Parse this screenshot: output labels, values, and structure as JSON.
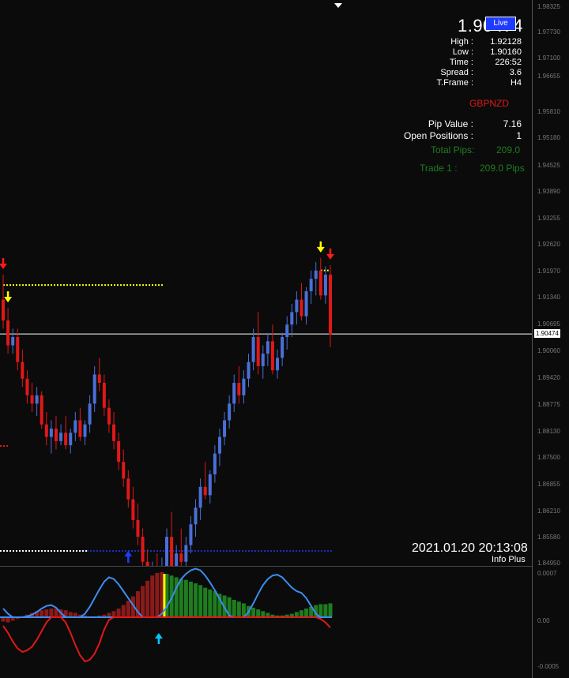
{
  "price": {
    "current": "1.90474",
    "badge": "Live"
  },
  "stats": [
    {
      "label": "High :",
      "value": "1.92128"
    },
    {
      "label": "Low :",
      "value": "1.90160"
    },
    {
      "label": "Time :",
      "value": "226:52"
    },
    {
      "label": "Spread :",
      "value": "3.6"
    },
    {
      "label": "T.Frame :",
      "value": "H4"
    }
  ],
  "symbol": "GBPNZD",
  "account": [
    {
      "label": "Pip Value :",
      "value": "7.16"
    },
    {
      "label": "Open Positions :",
      "value": "1"
    }
  ],
  "total_pips": {
    "label": "Total Pips:",
    "value": "209.0"
  },
  "trade": {
    "label": "Trade 1 :",
    "value": "209.0 Pips"
  },
  "datetime": "2021.01.20 20:13:08",
  "info_plus": "Info Plus",
  "colors": {
    "bull": "#4a6fd8",
    "bear": "#e01818",
    "arrow_up_red": "#ff1a1a",
    "arrow_up_yellow": "#ffff00",
    "green": "#1f7d1f",
    "osc_blue": "#3b8ef0"
  },
  "chart_data": [
    {
      "type": "candlestick",
      "title": "",
      "price_axis_ticks": [
        "1.98325",
        "1.97730",
        "1.97100",
        "1.96655",
        "1.95810",
        "1.95180",
        "1.94525",
        "1.93890",
        "1.93255",
        "1.92620",
        "1.91970",
        "1.91340",
        "1.90695",
        "1.90060",
        "1.89420",
        "1.88775",
        "1.88130",
        "1.87500",
        "1.86855",
        "1.86210",
        "1.85580",
        "1.84950"
      ],
      "ylim": [
        1.849,
        1.985
      ],
      "current_price_line": 1.90474,
      "current_price_tag": "1.90474",
      "candles": [
        [
          1.913,
          1.919,
          1.906,
          1.908
        ],
        [
          1.908,
          1.911,
          1.9,
          1.902
        ],
        [
          1.902,
          1.906,
          1.9,
          1.904
        ],
        [
          1.904,
          1.906,
          1.896,
          1.898
        ],
        [
          1.898,
          1.901,
          1.892,
          1.894
        ],
        [
          1.894,
          1.896,
          1.888,
          1.89
        ],
        [
          1.89,
          1.893,
          1.886,
          1.888
        ],
        [
          1.888,
          1.892,
          1.885,
          1.89
        ],
        [
          1.89,
          1.891,
          1.882,
          1.883
        ],
        [
          1.883,
          1.886,
          1.878,
          1.88
        ],
        [
          1.88,
          1.884,
          1.876,
          1.882
        ],
        [
          1.882,
          1.885,
          1.877,
          1.879
        ],
        [
          1.879,
          1.883,
          1.878,
          1.881
        ],
        [
          1.881,
          1.885,
          1.877,
          1.878
        ],
        [
          1.878,
          1.882,
          1.876,
          1.881
        ],
        [
          1.881,
          1.886,
          1.879,
          1.884
        ],
        [
          1.884,
          1.887,
          1.879,
          1.88
        ],
        [
          1.88,
          1.884,
          1.878,
          1.883
        ],
        [
          1.883,
          1.89,
          1.881,
          1.888
        ],
        [
          1.888,
          1.897,
          1.886,
          1.895
        ],
        [
          1.895,
          1.899,
          1.891,
          1.893
        ],
        [
          1.893,
          1.895,
          1.885,
          1.887
        ],
        [
          1.887,
          1.889,
          1.881,
          1.883
        ],
        [
          1.883,
          1.886,
          1.877,
          1.879
        ],
        [
          1.879,
          1.881,
          1.872,
          1.874
        ],
        [
          1.874,
          1.877,
          1.868,
          1.87
        ],
        [
          1.87,
          1.872,
          1.863,
          1.865
        ],
        [
          1.865,
          1.868,
          1.858,
          1.86
        ],
        [
          1.86,
          1.864,
          1.854,
          1.856
        ],
        [
          1.856,
          1.858,
          1.849,
          1.85
        ],
        [
          1.85,
          1.853,
          1.844,
          1.846
        ],
        [
          1.846,
          1.85,
          1.842,
          1.848
        ],
        [
          1.848,
          1.852,
          1.841,
          1.843
        ],
        [
          1.843,
          1.851,
          1.84,
          1.849
        ],
        [
          1.849,
          1.858,
          1.847,
          1.856
        ],
        [
          1.856,
          1.862,
          1.845,
          1.847
        ],
        [
          1.847,
          1.854,
          1.845,
          1.852
        ],
        [
          1.852,
          1.858,
          1.849,
          1.85
        ],
        [
          1.85,
          1.856,
          1.848,
          1.854
        ],
        [
          1.854,
          1.861,
          1.852,
          1.859
        ],
        [
          1.859,
          1.865,
          1.856,
          1.863
        ],
        [
          1.863,
          1.87,
          1.86,
          1.868
        ],
        [
          1.868,
          1.874,
          1.865,
          1.866
        ],
        [
          1.866,
          1.872,
          1.864,
          1.871
        ],
        [
          1.871,
          1.878,
          1.869,
          1.876
        ],
        [
          1.876,
          1.882,
          1.873,
          1.88
        ],
        [
          1.88,
          1.886,
          1.878,
          1.884
        ],
        [
          1.884,
          1.89,
          1.882,
          1.888
        ],
        [
          1.888,
          1.895,
          1.886,
          1.893
        ],
        [
          1.893,
          1.897,
          1.888,
          1.89
        ],
        [
          1.89,
          1.896,
          1.888,
          1.894
        ],
        [
          1.894,
          1.9,
          1.892,
          1.898
        ],
        [
          1.898,
          1.906,
          1.896,
          1.904
        ],
        [
          1.904,
          1.91,
          1.895,
          1.897
        ],
        [
          1.897,
          1.902,
          1.894,
          1.9
        ],
        [
          1.9,
          1.905,
          1.897,
          1.903
        ],
        [
          1.903,
          1.907,
          1.895,
          1.896
        ],
        [
          1.896,
          1.901,
          1.894,
          1.899
        ],
        [
          1.899,
          1.905,
          1.897,
          1.904
        ],
        [
          1.904,
          1.909,
          1.901,
          1.907
        ],
        [
          1.907,
          1.912,
          1.904,
          1.91
        ],
        [
          1.91,
          1.915,
          1.907,
          1.913
        ],
        [
          1.913,
          1.917,
          1.908,
          1.909
        ],
        [
          1.909,
          1.916,
          1.907,
          1.915
        ],
        [
          1.915,
          1.92,
          1.912,
          1.918
        ],
        [
          1.918,
          1.922,
          1.914,
          1.92
        ],
        [
          1.92,
          1.923,
          1.913,
          1.914
        ],
        [
          1.914,
          1.921,
          1.912,
          1.919
        ],
        [
          1.919,
          1.9213,
          1.9016,
          1.9047
        ]
      ],
      "signals": [
        {
          "candle": 0,
          "dir": "down",
          "color": "red"
        },
        {
          "candle": 1,
          "dir": "down",
          "color": "yellow"
        },
        {
          "candle": 30,
          "dir": "up",
          "color": "red"
        },
        {
          "candle": 33,
          "dir": "up",
          "color": "yellow"
        },
        {
          "candle": 66,
          "dir": "down",
          "color": "yellow"
        },
        {
          "candle": 68,
          "dir": "down",
          "color": "red"
        }
      ],
      "levels": [
        {
          "from": 0,
          "to": 33,
          "price": 1.9165,
          "color": "yellow"
        },
        {
          "from": 30,
          "to": 68,
          "price": 1.8418,
          "color": "yellow"
        },
        {
          "from": 66,
          "to": 68,
          "price": 1.92,
          "color": "yellow"
        }
      ]
    },
    {
      "type": "oscillator",
      "title": "",
      "axis_ticks": [
        "0.0007",
        "0.00",
        "-0.0005"
      ],
      "histogram": [
        -0.5,
        -0.6,
        -0.4,
        -0.2,
        0.1,
        0.3,
        0.5,
        0.7,
        0.8,
        0.9,
        1.0,
        1.0,
        0.9,
        0.8,
        0.6,
        0.5,
        0.3,
        0.2,
        0.1,
        0.1,
        0.2,
        0.3,
        0.5,
        0.7,
        1.0,
        1.4,
        1.9,
        2.4,
        3.0,
        3.6,
        4.2,
        4.8,
        5.1,
        5.2,
        5.0,
        4.8,
        4.6,
        4.4,
        4.3,
        4.1,
        3.9,
        3.7,
        3.4,
        3.2,
        3.0,
        2.7,
        2.5,
        2.3,
        2.0,
        1.8,
        1.6,
        1.3,
        1.1,
        0.9,
        0.7,
        0.5,
        0.3,
        0.2,
        0.2,
        0.3,
        0.4,
        0.6,
        0.8,
        1.0,
        1.2,
        1.4,
        1.5,
        1.5,
        1.6
      ],
      "blue_line": [
        1.0,
        0.4,
        0.0,
        0.0,
        0.0,
        0.1,
        0.3,
        0.6,
        1.0,
        1.3,
        1.4,
        1.1,
        0.5,
        0.0,
        0.0,
        0.0,
        0.0,
        0.4,
        1.2,
        2.2,
        3.2,
        4.1,
        4.6,
        4.4,
        3.8,
        3.0,
        2.2,
        1.4,
        0.6,
        0.0,
        0.0,
        0.0,
        0.0,
        0.4,
        1.2,
        2.2,
        3.4,
        4.4,
        5.0,
        5.4,
        5.6,
        5.4,
        4.8,
        4.0,
        3.1,
        2.1,
        1.1,
        0.2,
        0.0,
        0.0,
        0.0,
        0.6,
        1.6,
        2.7,
        3.7,
        4.4,
        4.8,
        4.9,
        4.6,
        4.0,
        3.4,
        3.0,
        2.8,
        2.2,
        1.3,
        0.4,
        0.0,
        0.0,
        0.0
      ],
      "red_line": [
        -1.0,
        -1.8,
        -2.8,
        -3.6,
        -4.0,
        -3.8,
        -3.4,
        -2.6,
        -1.6,
        -0.6,
        0.0,
        0.0,
        0.0,
        -0.6,
        -1.8,
        -3.2,
        -4.4,
        -5.1,
        -4.9,
        -4.2,
        -3.0,
        -1.4,
        -0.3,
        0.0,
        0.0,
        0.0,
        0.0,
        0.0,
        0.0,
        0.0,
        0.0,
        0.0,
        0.0,
        0.0,
        0.0,
        0.0,
        0.0,
        0.0,
        0.0,
        0.0,
        0.0,
        0.0,
        0.0,
        0.0,
        0.0,
        0.0,
        0.0,
        0.0,
        0.0,
        0.0,
        0.0,
        0.0,
        0.0,
        0.0,
        0.0,
        0.0,
        0.0,
        0.0,
        0.0,
        0.0,
        0.0,
        0.0,
        0.0,
        0.0,
        0.0,
        0.0,
        -0.2,
        -0.6,
        -1.2
      ]
    }
  ]
}
